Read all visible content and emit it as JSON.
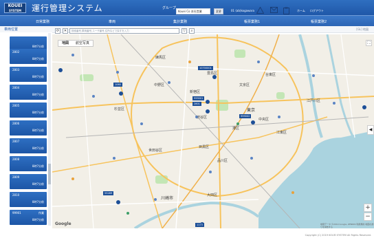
{
  "header": {
    "logo_text": "KOUEI",
    "logo_sub": "SYSTEM",
    "app_title": "運行管理システム",
    "group_label": "グループ",
    "group_value": "Kouei Co 本社営業",
    "group_button": "変更",
    "user": "01 (ab)kogawara",
    "icons": [
      "warning-icon",
      "mail-icon",
      "clipboard-icon"
    ],
    "links": [
      "ホーム",
      "ログアウト"
    ]
  },
  "nav": {
    "items": [
      "日常業務",
      "車両",
      "集計業務",
      "帳票業務1",
      "帳票業務2"
    ]
  },
  "page": {
    "title": "車両位置",
    "map_source": "[GL] 地図"
  },
  "toolbar": {
    "search_placeholder": "検索番号,車両番号,ユーザ番号,住所などで探すを入力"
  },
  "map": {
    "type_options": [
      "地図",
      "航空写真"
    ],
    "selected_type": "地図",
    "zoom_in": "+",
    "zoom_out": "−",
    "fullscreen": "⛶",
    "collapse": "◀",
    "vehicle_tags": [
      "10700001",
      "1060",
      "999001",
      "2801",
      "999002",
      "55289",
      "1173"
    ],
    "place_labels": [
      "練馬区",
      "豊島区",
      "文京区",
      "新宿区",
      "中野区",
      "渋谷区",
      "港区",
      "品川区",
      "大田区",
      "世田谷区",
      "杉並区",
      "目黒区",
      "川崎市",
      "東京",
      "江戸川区",
      "江東区",
      "台東区",
      "中央区"
    ],
    "attribution": "地図データ ©2019 Google, ZENRIN 利用規約 地図の誤りを報告する",
    "google": "Google"
  },
  "vehicles": [
    {
      "number": "",
      "time": "8時7分前"
    },
    {
      "number": "2802",
      "time": "8時7分前"
    },
    {
      "number": "2803",
      "time": "8時7分前"
    },
    {
      "number": "2804",
      "time": "8時7分前"
    },
    {
      "number": "2805",
      "time": "8時7分前"
    },
    {
      "number": "2806",
      "time": "8時7分前"
    },
    {
      "number": "2807",
      "time": "8時7分前"
    },
    {
      "number": "2808",
      "time": "8時7分前"
    },
    {
      "number": "2809",
      "time": "8時7分前"
    },
    {
      "number": "2810",
      "time": "8時7分前"
    },
    {
      "number": "99901",
      "time": "8時7分前",
      "status": "作業"
    }
  ],
  "footer": {
    "copyright": "Copyright (C) 2019 KOUEI SYSTEM All Rights Reserved."
  },
  "colors": {
    "header": "#2f6fc0",
    "nav": "#2a63b3",
    "card": "#1d56a6"
  }
}
